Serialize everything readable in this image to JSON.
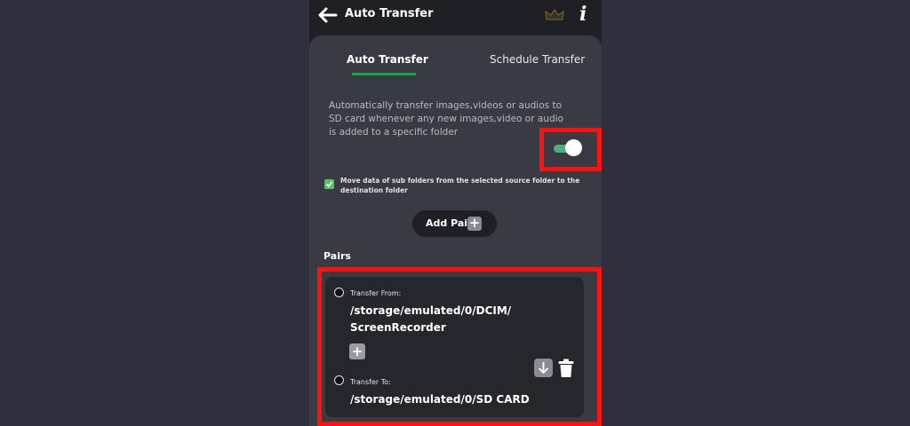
{
  "appbar": {
    "title": "Auto Transfer",
    "info_glyph": "i",
    "icons": [
      "back-arrow-icon",
      "crown-icon",
      "info-icon"
    ]
  },
  "tabs": [
    {
      "label": "Auto Transfer",
      "active": true
    },
    {
      "label": "Schedule Transfer",
      "active": false
    }
  ],
  "auto_transfer": {
    "description": "Automatically transfer images,videos or audios to SD card whenever any new images,video or audio is added to a specific folder",
    "enabled": true,
    "subfolder_checkbox": {
      "checked": true,
      "label": "Move data of sub folders from the selected source folder to the destination folder"
    },
    "add_pair_label": "Add Pair",
    "plus_glyph": "+"
  },
  "pairs": {
    "heading": "Pairs",
    "items": [
      {
        "from_label": "Transfer From:",
        "from_path_line1": "/storage/emulated/0/DCIM/",
        "from_path_line2": "ScreenRecorder",
        "to_label": "Transfer To:",
        "to_path": "/storage/emulated/0/SD CARD"
      }
    ]
  },
  "colors": {
    "background": "#2f2f3d",
    "screen": "#1f1f26",
    "card": "#3a3a44",
    "accent_green": "#18a54a",
    "toggle_track": "#4cb07a",
    "highlight_red": "#ff1111"
  }
}
